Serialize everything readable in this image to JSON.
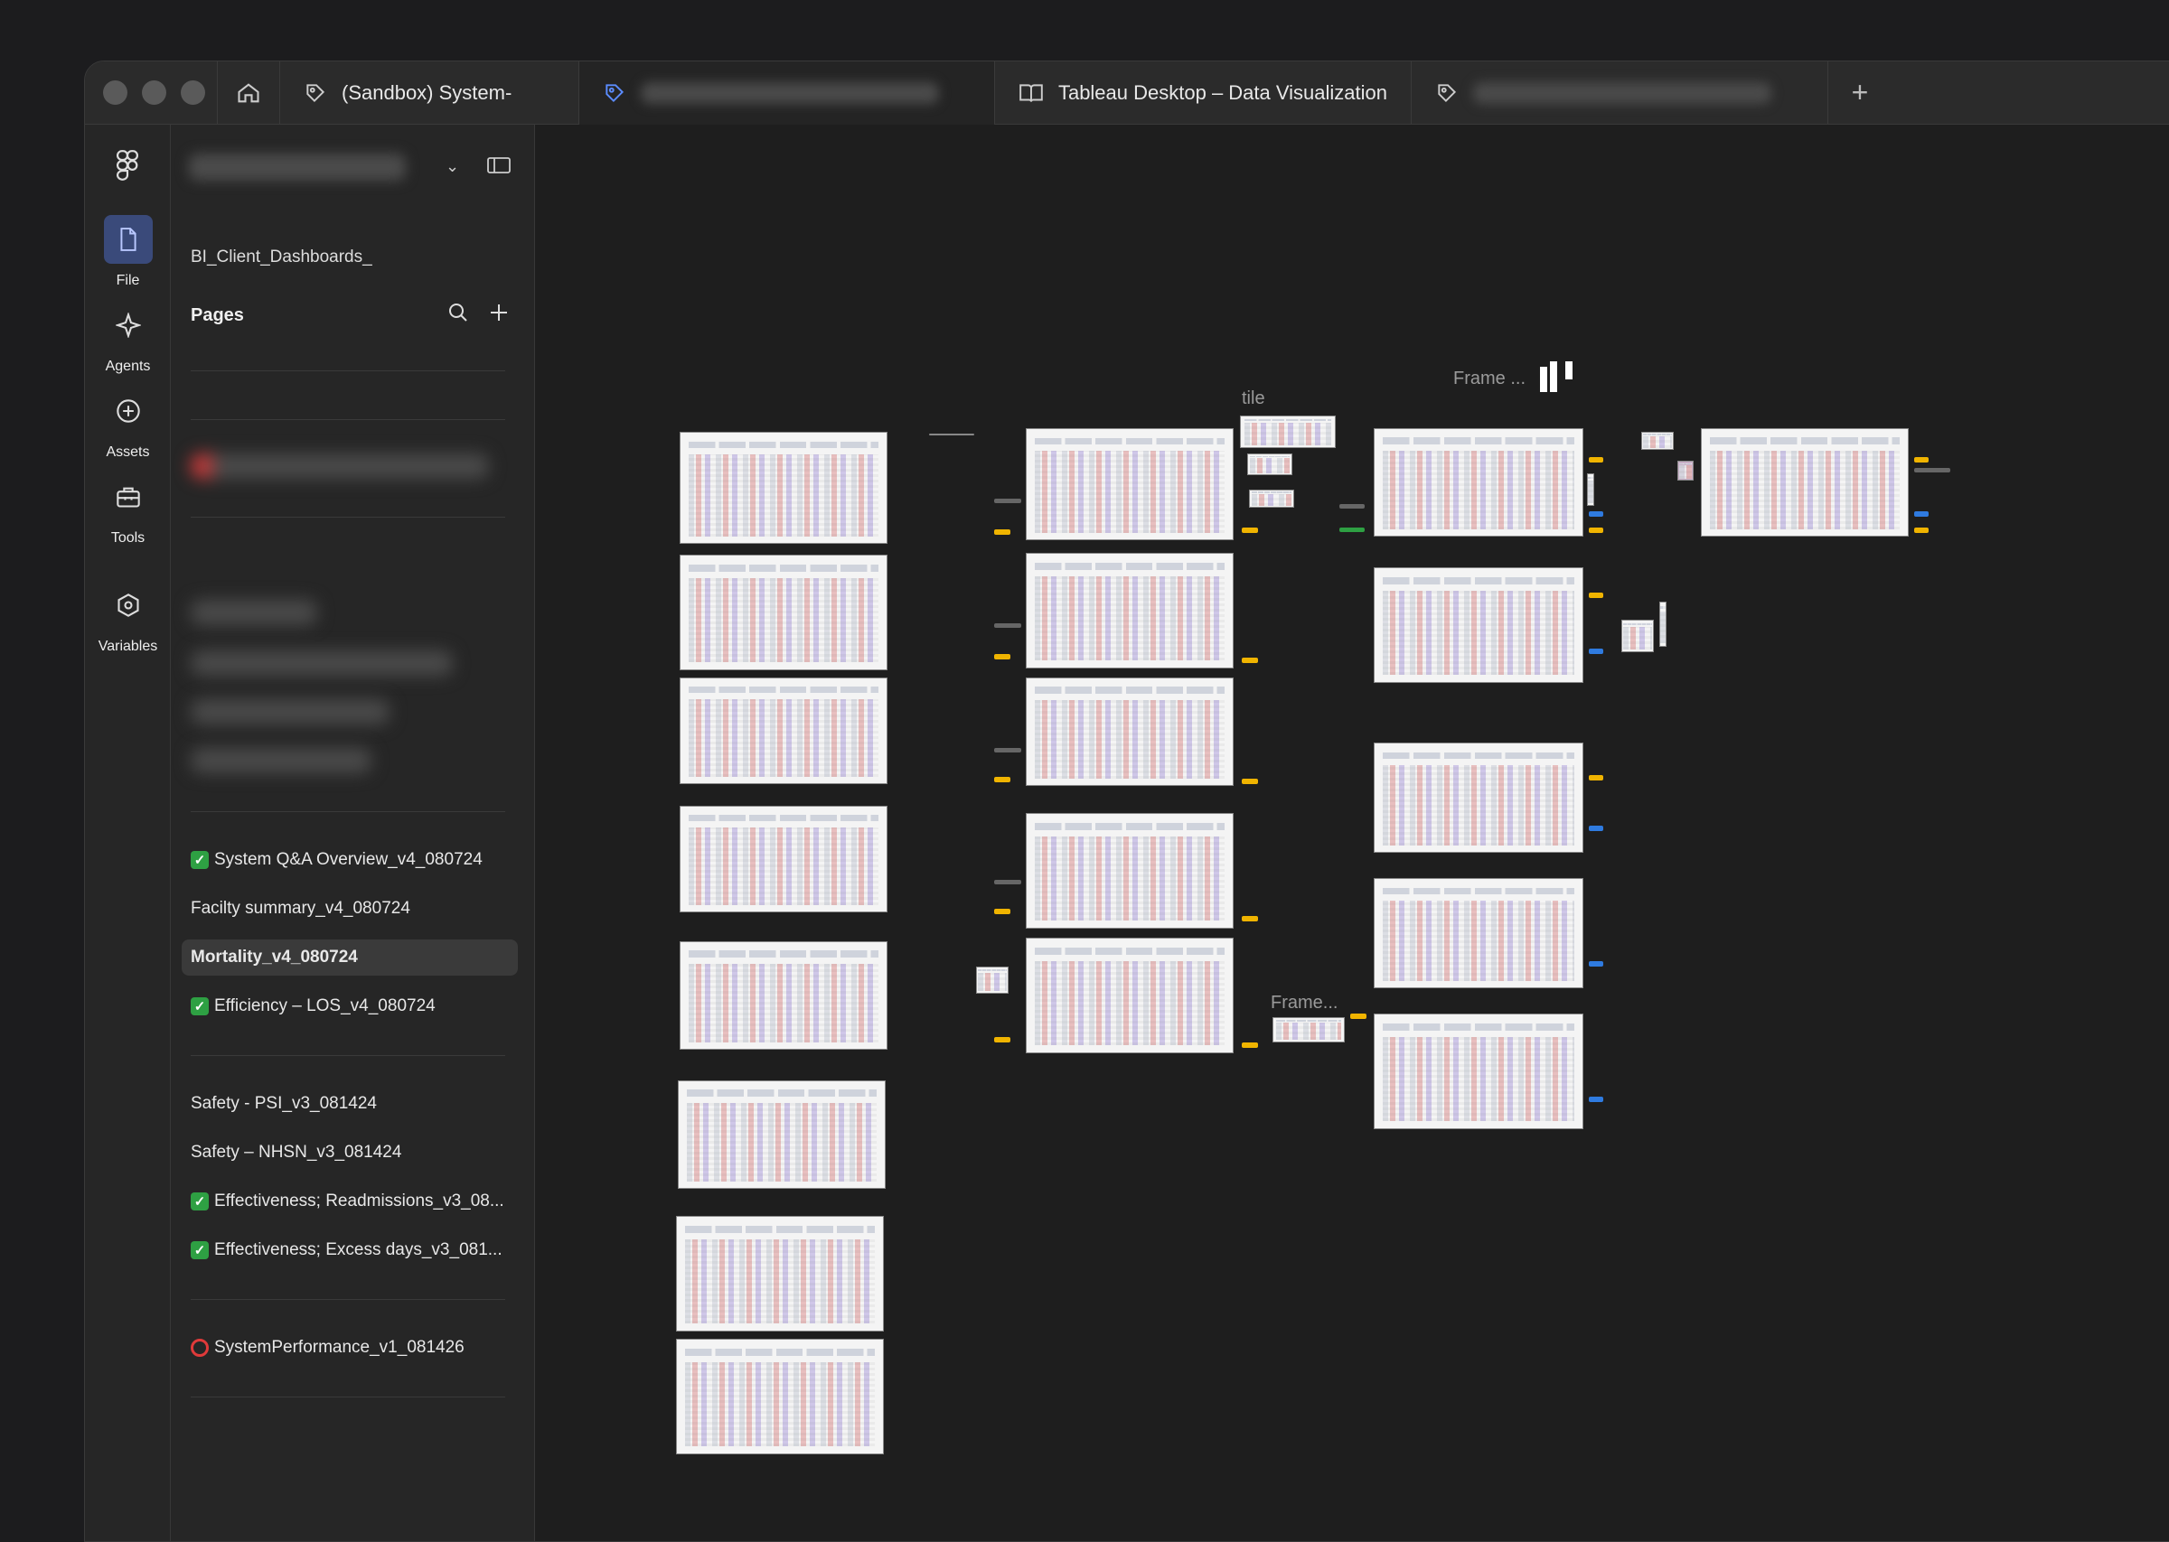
{
  "tabs": [
    {
      "label": "(Sandbox) System-",
      "icon": "figma-tag-icon"
    },
    {
      "label": "",
      "icon": "figma-tag-icon",
      "active": true
    },
    {
      "label": "Tableau Desktop – Data Visualization",
      "icon": "book-icon"
    },
    {
      "label": "",
      "icon": "figma-tag-icon"
    }
  ],
  "rail": {
    "items": [
      {
        "label": "File",
        "icon": "file-icon",
        "selected": true
      },
      {
        "label": "Agents",
        "icon": "sparkle-icon"
      },
      {
        "label": "Assets",
        "icon": "plus-circle-icon"
      },
      {
        "label": "Tools",
        "icon": "toolbox-icon"
      },
      {
        "label": "Variables",
        "icon": "hexagon-icon"
      }
    ]
  },
  "panel": {
    "file_name": "BI_Client_Dashboards_",
    "pages_title": "Pages",
    "pages": [
      {
        "label": "System Q&A Overview_v4_080724",
        "status": "check"
      },
      {
        "label": "Facilty summary_v4_080724",
        "status": ""
      },
      {
        "label": "Mortality_v4_080724",
        "status": "",
        "selected": true
      },
      {
        "label": "Efficiency – LOS_v4_080724",
        "status": "check"
      },
      {
        "label": "Safety - PSI_v3_081424",
        "status": ""
      },
      {
        "label": "Safety – NHSN_v3_081424",
        "status": ""
      },
      {
        "label": "Effectiveness; Readmissions_v3_08...",
        "status": "check"
      },
      {
        "label": "Effectiveness; Excess days_v3_081...",
        "status": "check"
      },
      {
        "label": "SystemPerformance_v1_081426",
        "status": "circle"
      }
    ]
  },
  "canvas": {
    "labels": {
      "tile": "tile",
      "frame_top": "Frame ...",
      "frame_bottom": "Frame..."
    }
  },
  "colors": {
    "accent_selected": "#3a4a7a",
    "check_green": "#2ea043",
    "circle_red": "#e03a3a",
    "annotation_yellow": "#f0b400",
    "annotation_blue": "#2f7be0"
  }
}
